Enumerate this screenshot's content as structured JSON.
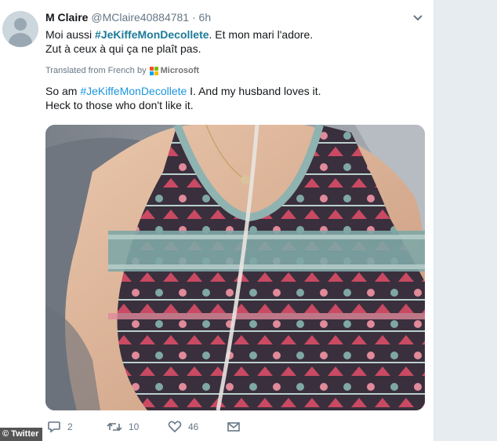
{
  "tweet": {
    "display_name": "M Claire",
    "handle": "@MClaire40884781",
    "separator": "·",
    "time": "6h",
    "text_line1_prefix": "Moi aussi ",
    "text_line1_hashtag": "#JeKiffeMonDecollete",
    "text_line1_suffix": ". Et mon mari l'adore.",
    "text_line2": "Zut à ceux à qui ça ne plaît pas.",
    "translated_from": "Translated from French by",
    "translator_name": "Microsoft",
    "translation_line1_prefix": "So am ",
    "translation_line1_hashtag": "#JeKiffeMonDecollete",
    "translation_line1_suffix": " I. And my husband loves it.",
    "translation_line2": "Heck to those who don't like it.",
    "more_icon": "chevron-down-icon",
    "avatar_icon": "default-avatar-icon"
  },
  "actions": {
    "reply_count": "2",
    "retweet_count": "10",
    "like_count": "46",
    "reply_icon": "reply-icon",
    "retweet_icon": "retweet-icon",
    "like_icon": "heart-icon",
    "dm_icon": "envelope-icon"
  },
  "credit": {
    "label": "© Twitter"
  },
  "colors": {
    "hashtag": "#1c7a99",
    "hashtag_translation": "#1b95e0",
    "meta_gray": "#657786",
    "background": "#e6ecf0",
    "ms_red": "#f25022",
    "ms_green": "#7fba00",
    "ms_blue": "#00a4ef",
    "ms_yellow": "#ffb900"
  }
}
